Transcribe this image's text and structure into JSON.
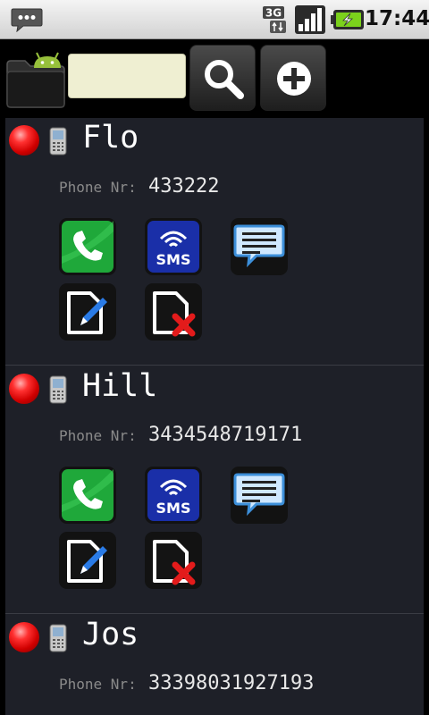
{
  "status_bar": {
    "network_label": "3G",
    "time": "17:44",
    "icons": [
      "message-notification-icon",
      "3g-data-icon",
      "signal-strength-icon",
      "battery-charging-icon"
    ]
  },
  "toolbar": {
    "search_value": "",
    "icons": [
      "android-folder-icon",
      "search-icon",
      "add-icon"
    ]
  },
  "contacts": [
    {
      "name": "Flo",
      "phone_label": "Phone Nr:",
      "phone_number": "433222"
    },
    {
      "name": "Hill",
      "phone_label": "Phone Nr:",
      "phone_number": "3434548719171"
    },
    {
      "name": "Jos",
      "phone_label": "Phone Nr:",
      "phone_number": "33398031927193"
    }
  ],
  "actions": {
    "sms_label": "SMS",
    "icons": [
      "call-icon",
      "sms-icon",
      "message-icon",
      "edit-contact-icon",
      "delete-contact-icon"
    ]
  },
  "colors": {
    "search_field": "#efefd2",
    "status_red": "#e00000",
    "call_green": "#1fa83a",
    "sms_blue": "#1a2fa8",
    "delete_red": "#e31b1b",
    "edit_blue": "#2a7be6",
    "list_background": "#1e2028"
  }
}
